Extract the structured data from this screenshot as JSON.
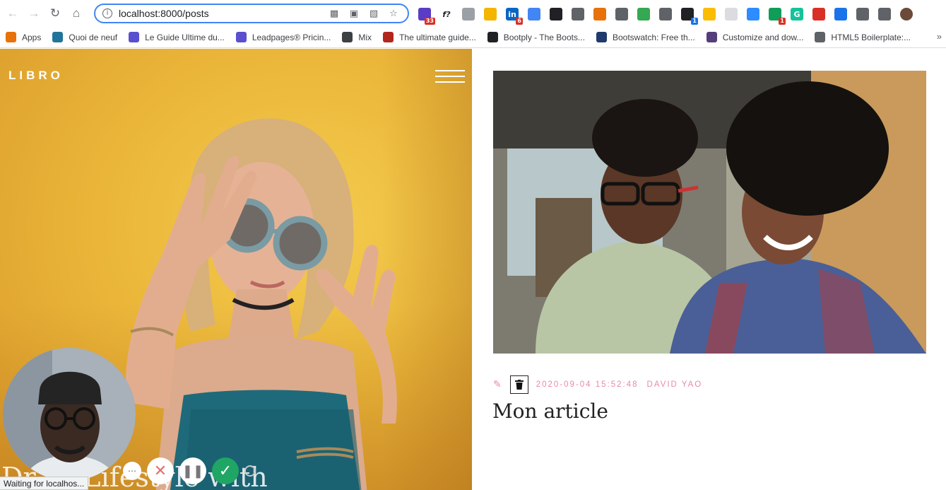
{
  "browser": {
    "url": "localhost:8000/posts",
    "extensions": [
      {
        "icon": "graduation-cap-ext-icon",
        "badge": "33",
        "color": "#5b3cc4"
      },
      {
        "icon": "function-ext-icon",
        "label": "f?",
        "color": "#ffffff"
      },
      {
        "icon": "page-ext-icon",
        "color": "#9aa0a6"
      },
      {
        "icon": "emoji-ext-icon",
        "color": "#f4b400"
      },
      {
        "icon": "linkedin-ext-icon",
        "label": "in",
        "badge": "6",
        "color": "#0a66c2"
      },
      {
        "icon": "translate-ext-icon",
        "color": "#4285f4"
      },
      {
        "icon": "grid-ext-icon",
        "color": "#202124"
      },
      {
        "icon": "eyedropper-ext-icon",
        "color": "#5f6368"
      },
      {
        "icon": "circle-ext-icon",
        "color": "#e8710a"
      },
      {
        "icon": "square-ext-icon",
        "color": "#5f6368"
      },
      {
        "icon": "green-dot-ext-icon",
        "color": "#34a853"
      },
      {
        "icon": "camera-ext-icon",
        "color": "#5f6368"
      },
      {
        "icon": "cube-ext-icon",
        "badge": "1",
        "badge_color": "blue",
        "color": "#202124"
      },
      {
        "icon": "shield-ext-icon",
        "color": "#fbbc04"
      },
      {
        "icon": "frame-ext-icon",
        "color": "#dadce0"
      },
      {
        "icon": "video-ext-icon",
        "color": "#2d8cff"
      },
      {
        "icon": "sheet-ext-icon",
        "badge": "1",
        "color": "#0f9d58"
      },
      {
        "icon": "grammarly-ext-icon",
        "label": "G",
        "color": "#15c39a"
      },
      {
        "icon": "target-ext-icon",
        "color": "#d93025"
      },
      {
        "icon": "download-ext-icon",
        "color": "#1a73e8"
      },
      {
        "icon": "refresh-ext-icon",
        "color": "#5f6368"
      },
      {
        "icon": "puzzle-ext-icon",
        "color": "#5f6368"
      },
      {
        "icon": "profile-avatar-icon",
        "color": "#6b4a3a"
      }
    ],
    "bookmarks": [
      {
        "label": "Apps",
        "icon": "apps-grid-icon",
        "color": "#e8710a"
      },
      {
        "label": "Quoi de neuf",
        "icon": "wordpress-icon",
        "color": "#21759b"
      },
      {
        "label": "Le Guide Ultime du...",
        "icon": "leadpages-icon",
        "color": "#5a4fcf"
      },
      {
        "label": "Leadpages® Pricin...",
        "icon": "leadpages-icon",
        "color": "#5a4fcf"
      },
      {
        "label": "Mix",
        "icon": "paper-plane-icon",
        "color": "#3c4043"
      },
      {
        "label": "The ultimate guide...",
        "icon": "w-logo-icon",
        "color": "#b3261e"
      },
      {
        "label": "Bootply - The Boots...",
        "icon": "c-logo-icon",
        "color": "#202124"
      },
      {
        "label": "Bootswatch: Free th...",
        "icon": "b-logo-icon",
        "color": "#1f3b6b"
      },
      {
        "label": "Customize and dow...",
        "icon": "bootstrap-icon",
        "color": "#563d7c"
      },
      {
        "label": "HTML5 Boilerplate:...",
        "icon": "globe-icon",
        "color": "#5f6368"
      }
    ],
    "more_bookmarks": "»"
  },
  "site": {
    "logo": "LIBRO",
    "hero_heading": "Dr ur Lifestyle with"
  },
  "post": {
    "date": "2020-09-04 15:52:48",
    "author": "DAVID YAO",
    "title": "Mon article"
  },
  "status": "Waiting for localhos..."
}
